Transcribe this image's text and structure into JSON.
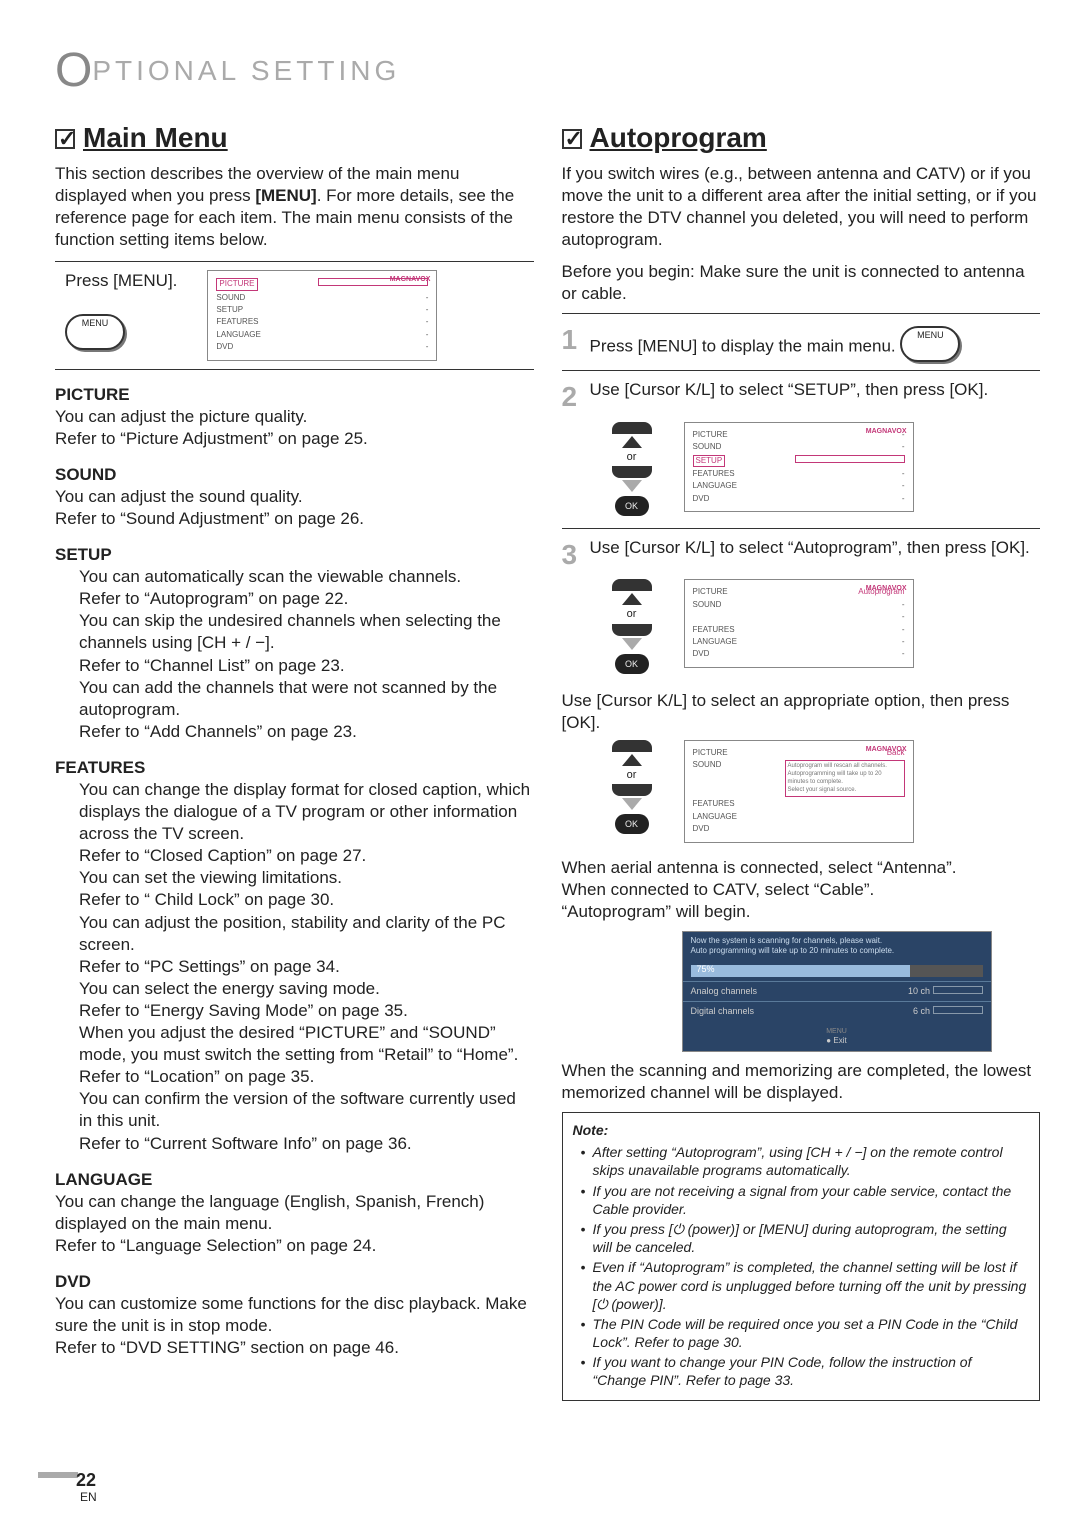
{
  "page": {
    "optionalO": "O",
    "optionalRest": "PTIONAL  SETTING",
    "number": "22",
    "en": "EN"
  },
  "left": {
    "title": "Main Menu",
    "intro1": "This section describes the overview of the main menu displayed when you press ",
    "menuWord": "[MENU]",
    "intro2": ". For more details, see the reference page for each item. The main menu consists of the function setting items below.",
    "pressMenu": "Press [MENU].",
    "menuLabel": "MENU",
    "picture": {
      "h": "PICTURE",
      "l1": "You can adjust the picture quality.",
      "l2": "Refer to “Picture Adjustment” on page 25."
    },
    "sound": {
      "h": "SOUND",
      "l1": "You can adjust the sound quality.",
      "l2": "Refer to “Sound Adjustment” on page 26."
    },
    "setup": {
      "h": "SETUP",
      "a1": "You can automatically scan the viewable channels.",
      "a2": "Refer to “Autoprogram” on page 22.",
      "b1": "You can skip the undesired channels when selecting the channels using [CH + / −].",
      "b2": "Refer to “Channel List” on page 23.",
      "c1": "You can add the channels that were not scanned by the autoprogram.",
      "c2": "Refer to “Add Channels” on page 23."
    },
    "features": {
      "h": "FEATURES",
      "a1": "You can change the display format for closed caption, which displays the dialogue of a TV program or other information across the TV screen.",
      "a2": "Refer to “Closed Caption” on page 27.",
      "b1": "You can set the viewing limitations.",
      "b2": "Refer to “ Child Lock” on page 30.",
      "c1": "You can adjust the position, stability and clarity of the PC screen.",
      "c2": "Refer to “PC Settings” on page 34.",
      "d1": "You can select the energy saving mode.",
      "d2": "Refer to “Energy Saving Mode” on page 35.",
      "e1": "When you adjust the desired “PICTURE” and “SOUND” mode, you must switch the setting from “Retail” to “Home”. Refer to “Location” on page 35.",
      "f1": "You can confirm the version of the software currently used in this unit.",
      "f2": "Refer to “Current Software Info” on page 36."
    },
    "language": {
      "h": "LANGUAGE",
      "l1": "You can change the language (English, Spanish, French) displayed on the main menu.",
      "l2": "Refer to “Language Selection” on page 24."
    },
    "dvd": {
      "h": "DVD",
      "l1": "You can customize some functions for the disc playback. Make sure the unit is in stop mode.",
      "l2": "Refer to “DVD SETTING” section on page 46."
    },
    "osd": {
      "brand": "MAGNAVOX",
      "items": [
        "PICTURE",
        "SOUND",
        "SETUP",
        "FEATURES",
        "LANGUAGE",
        "DVD"
      ]
    }
  },
  "right": {
    "title": "Autoprogram",
    "intro": "If you switch wires (e.g., between antenna and CATV) or if you move the unit to a different area after the initial setting, or if you restore the DTV channel you deleted, you will need to perform autoprogram.",
    "before": "Before you begin: Make sure the unit is connected to antenna or cable.",
    "s1": "Press [MENU] to display the main menu.",
    "s1menu": "MENU",
    "s2": "Use [Cursor K/L] to select “SETUP”, then press [OK].",
    "or": "or",
    "ok": "OK",
    "s3": "Use [Cursor K/L] to select “Autoprogram”, then press [OK].",
    "s3b": "Use [Cursor K/L] to select an appropriate option, then press [OK].",
    "osd2": {
      "brand": "MAGNAVOX",
      "hl": "SETUP",
      "items": [
        "PICTURE",
        "SOUND",
        "SETUP",
        "FEATURES",
        "LANGUAGE",
        "DVD"
      ]
    },
    "osd3": {
      "brand": "MAGNAVOX",
      "auto": "Autoprogram",
      "items": [
        "PICTURE",
        "SOUND",
        "",
        "FEATURES",
        "LANGUAGE",
        "DVD"
      ]
    },
    "osd4": {
      "brand": "MAGNAVOX",
      "back": "Back",
      "msg1": "Autoprogram will rescan all channels.",
      "msg2": "Autoprogramming will take up to 20 minutes to complete.",
      "msg3": "Select your signal source.",
      "items": [
        "PICTURE",
        "SOUND",
        "",
        "FEATURES",
        "LANGUAGE",
        "DVD"
      ]
    },
    "aerial1": "When aerial antenna is connected, select “Antenna”.",
    "aerial2": "When connected to CATV, select “Cable”.",
    "aerial3": "“Autoprogram” will begin.",
    "scan": {
      "h1": "Now the system is scanning for channels, please wait.",
      "h2": "Auto programming will take up to 20 minutes to complete.",
      "pct": "75%",
      "ana": "Analog channels",
      "anav": "10 ch",
      "dig": "Digital channels",
      "digv": "6 ch",
      "exit": "Exit",
      "exitlbl": "MENU"
    },
    "after": "When the scanning and memorizing are completed, the lowest memorized channel will be displayed.",
    "note": {
      "h": "Note:",
      "n1": "After setting “Autoprogram”, using [CH + / −] on the remote control skips unavailable programs automatically.",
      "n2": "If you are not receiving a signal from your cable service, contact the Cable provider.",
      "n3": "If you press [⏻ (power)] or [MENU] during autoprogram, the setting will be canceled.",
      "n4": "Even if “Autoprogram” is completed, the channel setting will be lost if the AC power cord is unplugged before turning off the unit by pressing [⏻ (power)].",
      "n5": "The PIN Code will be required once you set a PIN Code in the “Child Lock”. Refer to page 30.",
      "n6": "If you want to change your PIN Code, follow the instruction of “Change PIN”. Refer to page 33."
    }
  }
}
